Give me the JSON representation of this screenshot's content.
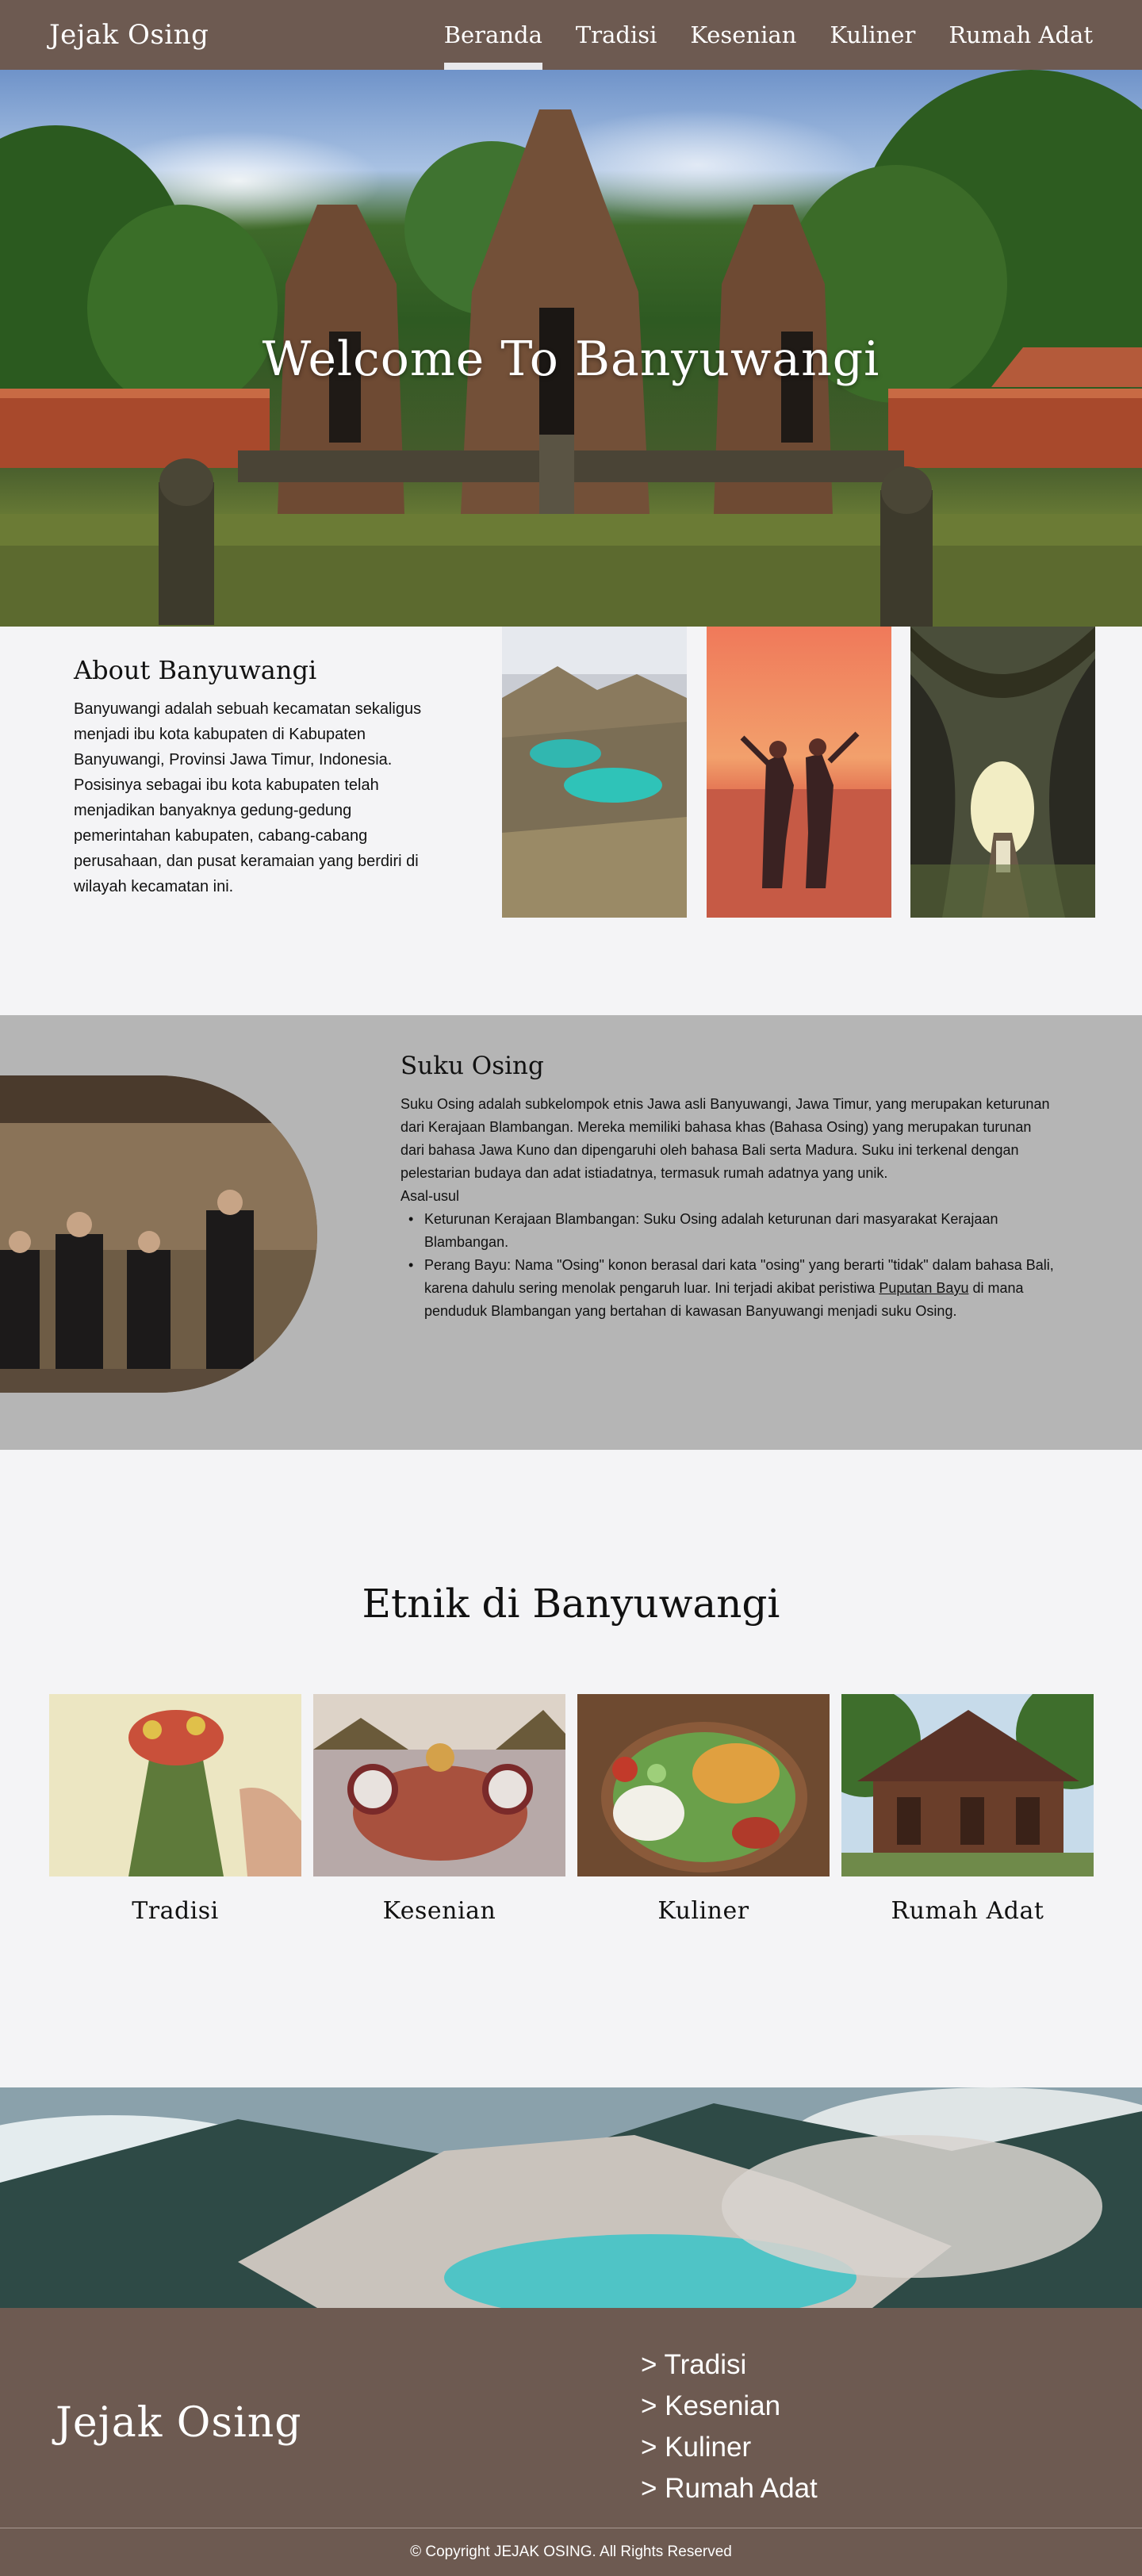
{
  "nav": {
    "brand": "Jejak Osing",
    "links": [
      "Beranda",
      "Tradisi",
      "Kesenian",
      "Kuliner",
      "Rumah Adat"
    ],
    "active": "Beranda"
  },
  "hero": {
    "title": "Welcome To Banyuwangi"
  },
  "about": {
    "title": "About Banyuwangi",
    "body": "Banyuwangi adalah sebuah kecamatan sekaligus menjadi ibu kota kabupaten di Kabupaten Banyuwangi, Provinsi Jawa Timur, Indonesia. Posisinya sebagai ibu kota kabupaten telah menjadikan banyaknya gedung-gedung pemerintahan kabupaten, cabang-cabang perusahaan, dan pusat keramaian yang berdiri di wilayah kecamatan ini."
  },
  "suku": {
    "title": "Suku Osing",
    "paragraph": "Suku Osing adalah subkelompok etnis Jawa asli Banyuwangi, Jawa Timur, yang merupakan keturunan dari Kerajaan Blambangan. Mereka memiliki bahasa khas (Bahasa Osing) yang merupakan turunan dari bahasa Jawa Kuno dan dipengaruhi oleh bahasa Bali serta Madura. Suku ini terkenal dengan pelestarian budaya dan adat istiadatnya, termasuk rumah adatnya yang unik.",
    "origin_label": "Asal-usul",
    "item1": "Keturunan Kerajaan Blambangan: Suku Osing adalah keturunan dari masyarakat Kerajaan Blambangan.",
    "item2_before": "Perang Bayu: Nama \"Osing\" konon berasal dari kata \"osing\" yang berarti \"tidak\" dalam bahasa Bali, karena dahulu sering menolak pengaruh luar. Ini terjadi akibat peristiwa ",
    "item2_link": "Puputan Bayu",
    "item2_after": " di mana penduduk Blambangan yang bertahan di kawasan Banyuwangi menjadi suku Osing."
  },
  "etnik": {
    "title": "Etnik di Banyuwangi",
    "cards": [
      "Tradisi",
      "Kesenian",
      "Kuliner",
      "Rumah Adat"
    ]
  },
  "footer": {
    "brand": "Jejak Osing",
    "links": [
      "> Tradisi",
      "> Kesenian",
      "> Kuliner",
      "> Rumah Adat"
    ],
    "copyright": "© Copyright JEJAK OSING. All Rights Reserved"
  },
  "colors": {
    "nav_bg": "#6d5a51",
    "page_bg": "#f4f4f6",
    "suku_bg": "#b5b5b5",
    "footer_bg": "#6d5a51"
  },
  "images": [
    "temple-hero-photo",
    "crater-lake-photo",
    "sunset-dancers-photo",
    "forest-path-photo",
    "osing-people-photo",
    "tradisi-photo",
    "kesenian-photo",
    "kuliner-photo",
    "rumah-adat-photo",
    "ijen-crater-photo"
  ]
}
